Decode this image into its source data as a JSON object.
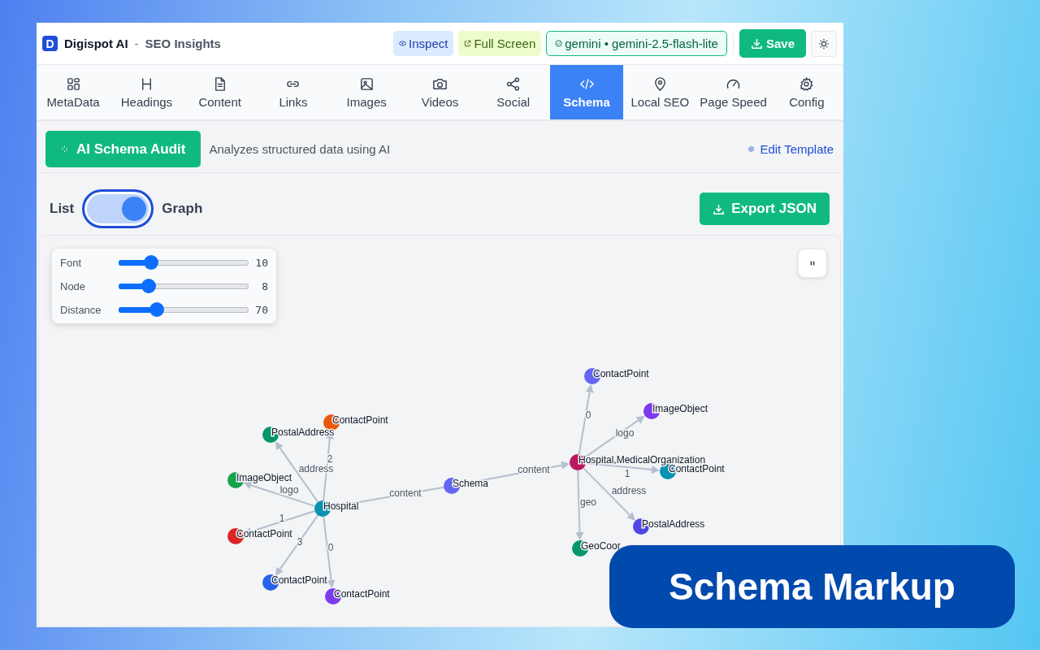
{
  "header": {
    "logo_letter": "D",
    "app_name": "Digispot AI",
    "separator": "-",
    "subtitle": "SEO Insights",
    "inspect": "Inspect",
    "full_screen": "Full Screen",
    "model": "gemini • gemini-2.5-flash-lite",
    "save": "Save"
  },
  "tabs": [
    {
      "label": "MetaData",
      "selected": false
    },
    {
      "label": "Headings",
      "selected": false
    },
    {
      "label": "Content",
      "selected": false
    },
    {
      "label": "Links",
      "selected": false
    },
    {
      "label": "Images",
      "selected": false
    },
    {
      "label": "Videos",
      "selected": false
    },
    {
      "label": "Social",
      "selected": false
    },
    {
      "label": "Schema",
      "selected": true
    },
    {
      "label": "Local SEO",
      "selected": false
    },
    {
      "label": "Page Speed",
      "selected": false
    },
    {
      "label": "Config",
      "selected": false
    }
  ],
  "audit": {
    "button": "AI Schema Audit",
    "description": "Analyzes structured data using AI",
    "edit_template": "Edit Template"
  },
  "view_toggle": {
    "left": "List",
    "right": "Graph",
    "on": true
  },
  "export": "Export JSON",
  "controls": [
    {
      "label": "Font",
      "level": 0.22,
      "value": "10"
    },
    {
      "label": "Node",
      "level": 0.2,
      "value": "8"
    },
    {
      "label": "Distance",
      "level": 0.27,
      "value": "70"
    }
  ],
  "graph": {
    "root": {
      "label": "Schema",
      "color": "#6366f1",
      "children": [
        {
          "edge": "content",
          "label": "Hospital",
          "color": "#0891b2",
          "children": [
            {
              "edge": "2",
              "label": "ContactPoint",
              "color": "#ea580c"
            },
            {
              "edge": "address",
              "label": "PostalAddress",
              "color": "#059669"
            },
            {
              "edge": "logo",
              "label": "ImageObject",
              "color": "#16a34a"
            },
            {
              "edge": "1",
              "label": "ContactPoint",
              "color": "#dc2626"
            },
            {
              "edge": "3",
              "label": "ContactPoint",
              "color": "#2563eb"
            },
            {
              "edge": "0",
              "label": "ContactPoint",
              "color": "#7c3aed"
            }
          ]
        },
        {
          "edge": "content",
          "label": "Hospital,MedicalOrganization",
          "color": "#be185d",
          "children": [
            {
              "edge": "0",
              "label": "ContactPoint",
              "color": "#6366f1"
            },
            {
              "edge": "logo",
              "label": "ImageObject",
              "color": "#7c3aed"
            },
            {
              "edge": "1",
              "label": "ContactPoint",
              "color": "#0891b2"
            },
            {
              "edge": "address",
              "label": "PostalAddress",
              "color": "#4f46e5"
            },
            {
              "edge": "geo",
              "label": "GeoCoor",
              "color": "#059669"
            }
          ]
        }
      ]
    }
  },
  "banner": {
    "text": "Schema Markup"
  }
}
